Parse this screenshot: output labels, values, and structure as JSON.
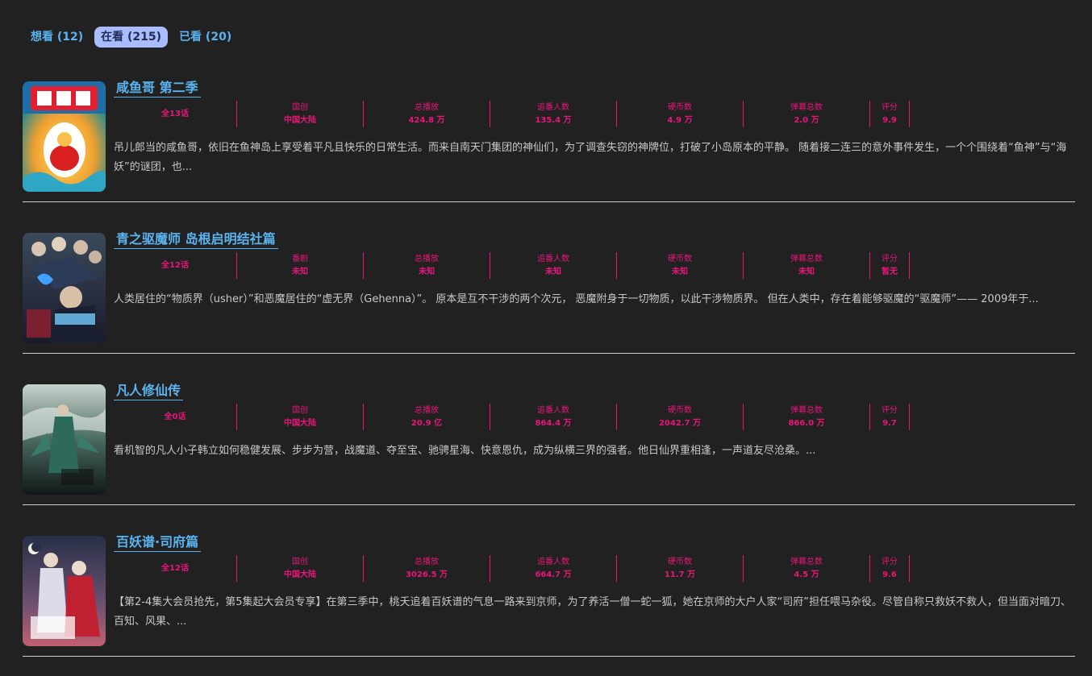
{
  "tabs": [
    {
      "label": "想看 (12)"
    },
    {
      "label": "在看 (215)"
    },
    {
      "label": "已看 (20)"
    }
  ],
  "stat_labels": {
    "type": "国创",
    "play": "总播放",
    "follow": "追番人数",
    "coin": "硬币数",
    "danmaku": "弹幕总数",
    "score": "评分"
  },
  "items": [
    {
      "title": "咸鱼哥 第二季",
      "episodes": "全13话",
      "type_label": "国创",
      "type_value": "中国大陆",
      "play": "424.8 万",
      "follow": "135.4 万",
      "coin": "4.9 万",
      "danmaku": "2.0 万",
      "score": "9.9",
      "desc": "吊儿郎当的咸鱼哥，依旧在鱼神岛上享受着平凡且快乐的日常生活。而来自南天门集团的神仙们，为了调查失窃的神牌位，打破了小岛原本的平静。 随着接二连三的意外事件发生，一个个围绕着“鱼神”与“海妖”的谜团，也..."
    },
    {
      "title": "青之驱魔师 岛根启明结社篇",
      "episodes": "全12话",
      "type_label": "番剧",
      "type_value": "未知",
      "play": "未知",
      "follow": "未知",
      "coin": "未知",
      "danmaku": "未知",
      "score": "暂无",
      "desc": "人类居住的“物质界（usher）”和恶魔居住的“虚无界（Gehenna）”。 原本是互不干涉的两个次元， 恶魔附身于一切物质，以此干涉物质界。 但在人类中，存在着能够驱魔的“驱魔师”—— 2009年于..."
    },
    {
      "title": "凡人修仙传",
      "episodes": "全0话",
      "type_label": "国创",
      "type_value": "中国大陆",
      "play": "20.9 亿",
      "follow": "864.4 万",
      "coin": "2042.7 万",
      "danmaku": "866.0 万",
      "score": "9.7",
      "desc": "看机智的凡人小子韩立如何稳健发展、步步为营，战魔道、夺至宝、驰骋星海、快意恩仇，成为纵横三界的强者。他日仙界重相逢，一声道友尽沧桑。..."
    },
    {
      "title": "百妖谱·司府篇",
      "episodes": "全12话",
      "type_label": "国创",
      "type_value": "中国大陆",
      "play": "3026.5 万",
      "follow": "664.7 万",
      "coin": "11.7 万",
      "danmaku": "4.5 万",
      "score": "9.6",
      "desc": "【第2-4集大会员抢先，第5集起大会员专享】在第三季中，桃夭追着百妖谱的气息一路来到京师，为了养活一僧一蛇一狐，她在京师的大户人家“司府”担任喂马杂役。尽管自称只救妖不救人，但当面对暗刀、百知、风果、..."
    }
  ]
}
